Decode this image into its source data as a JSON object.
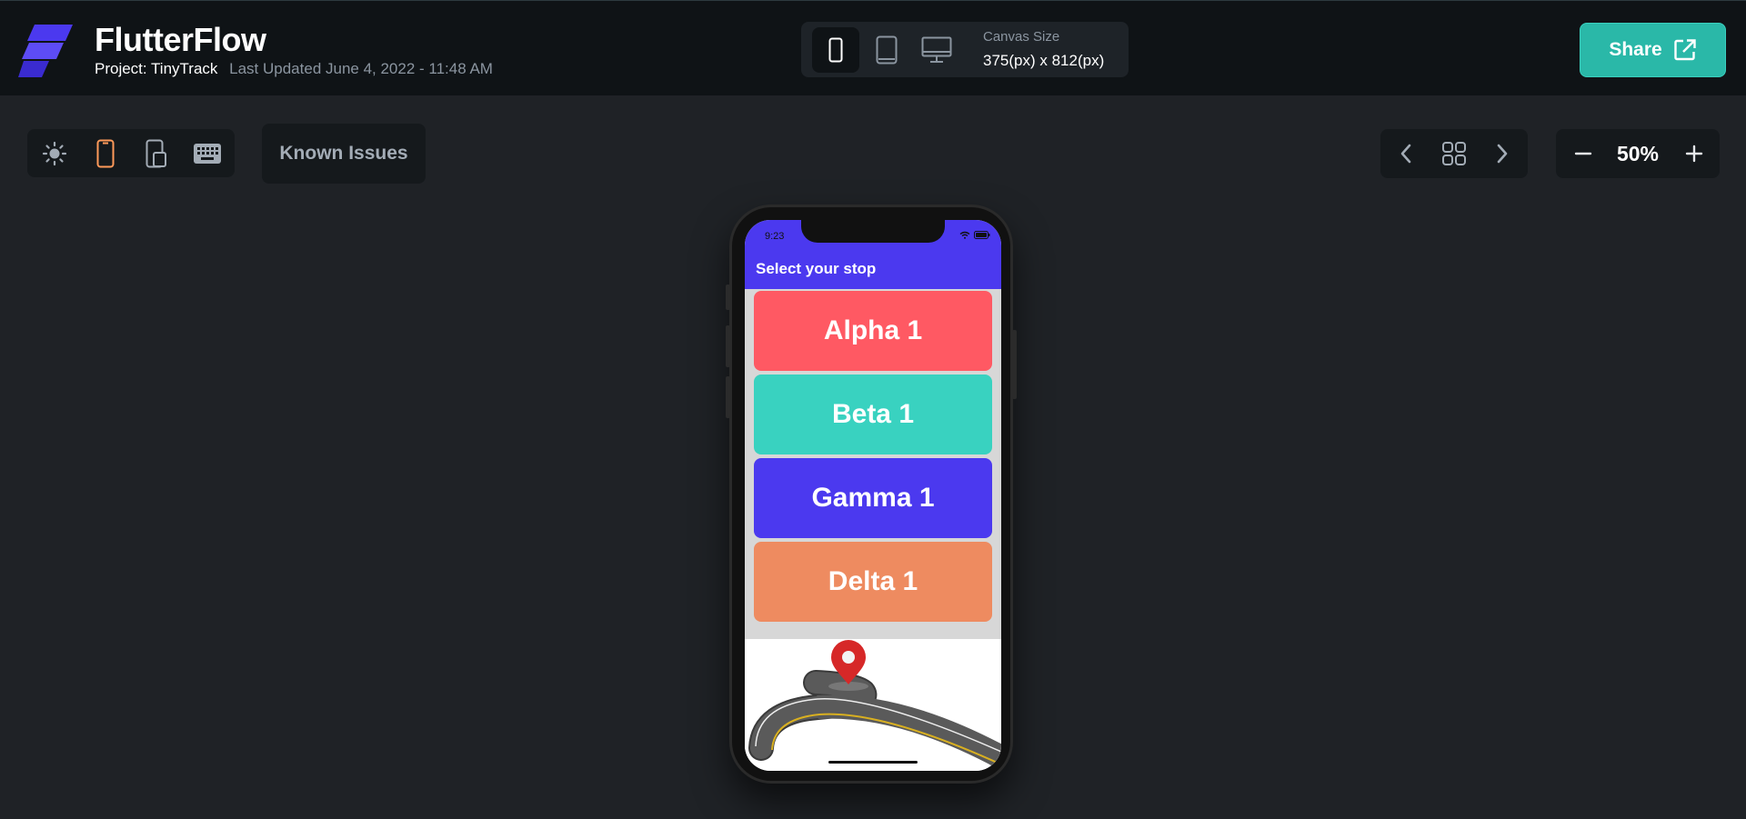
{
  "header": {
    "app_name": "FlutterFlow",
    "project_label": "Project: TinyTrack",
    "last_updated": "Last Updated June 4, 2022 - 11:48 AM",
    "canvas_size_label": "Canvas Size",
    "canvas_size_value": "375(px) x 812(px)",
    "share_label": "Share"
  },
  "toolbar": {
    "known_issues_label": "Known Issues",
    "zoom_value": "50%"
  },
  "preview": {
    "status_time": "9:23",
    "app_title": "Select your stop",
    "stops": [
      {
        "label": "Alpha 1",
        "color": "#ff5963"
      },
      {
        "label": "Beta 1",
        "color": "#39d2c0"
      },
      {
        "label": "Gamma 1",
        "color": "#4b39ef"
      },
      {
        "label": "Delta 1",
        "color": "#ee8b60"
      }
    ]
  },
  "colors": {
    "accent": "#2ab8a8",
    "active_device": "#ff9a5a",
    "brand": "#4b39ef"
  },
  "icons": [
    "flutterflow-logo",
    "phone-icon",
    "tablet-icon",
    "desktop-icon",
    "external-link-icon",
    "sun-icon",
    "phone-outline-icon",
    "phone-split-icon",
    "keyboard-icon",
    "chevron-left-icon",
    "grid-icon",
    "chevron-right-icon",
    "minus-icon",
    "plus-icon",
    "wifi-icon",
    "battery-icon",
    "map-pin-icon"
  ]
}
